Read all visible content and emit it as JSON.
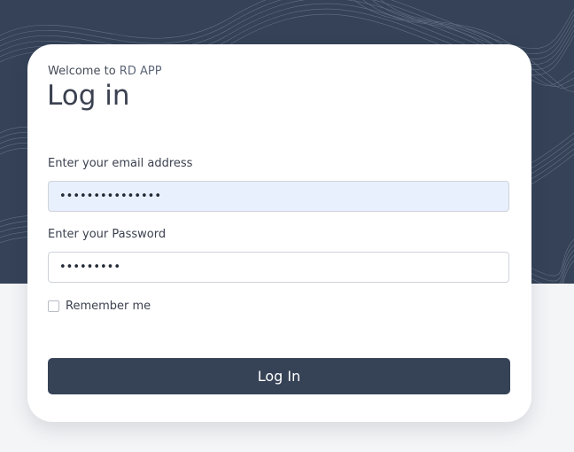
{
  "header": {
    "welcome_prefix": "Welcome to",
    "brand": "RD APP",
    "title": "Log in"
  },
  "form": {
    "email": {
      "label": "Enter your email address",
      "value": "•••••••••••••••"
    },
    "password": {
      "label": "Enter your Password",
      "value": "•••••••••"
    },
    "remember_label": "Remember me",
    "remember_checked": false,
    "submit_label": "Log In"
  },
  "colors": {
    "background_dark": "#354257",
    "button": "#364256",
    "autofill": "#e8f0fe",
    "page": "#f4f5f7"
  }
}
